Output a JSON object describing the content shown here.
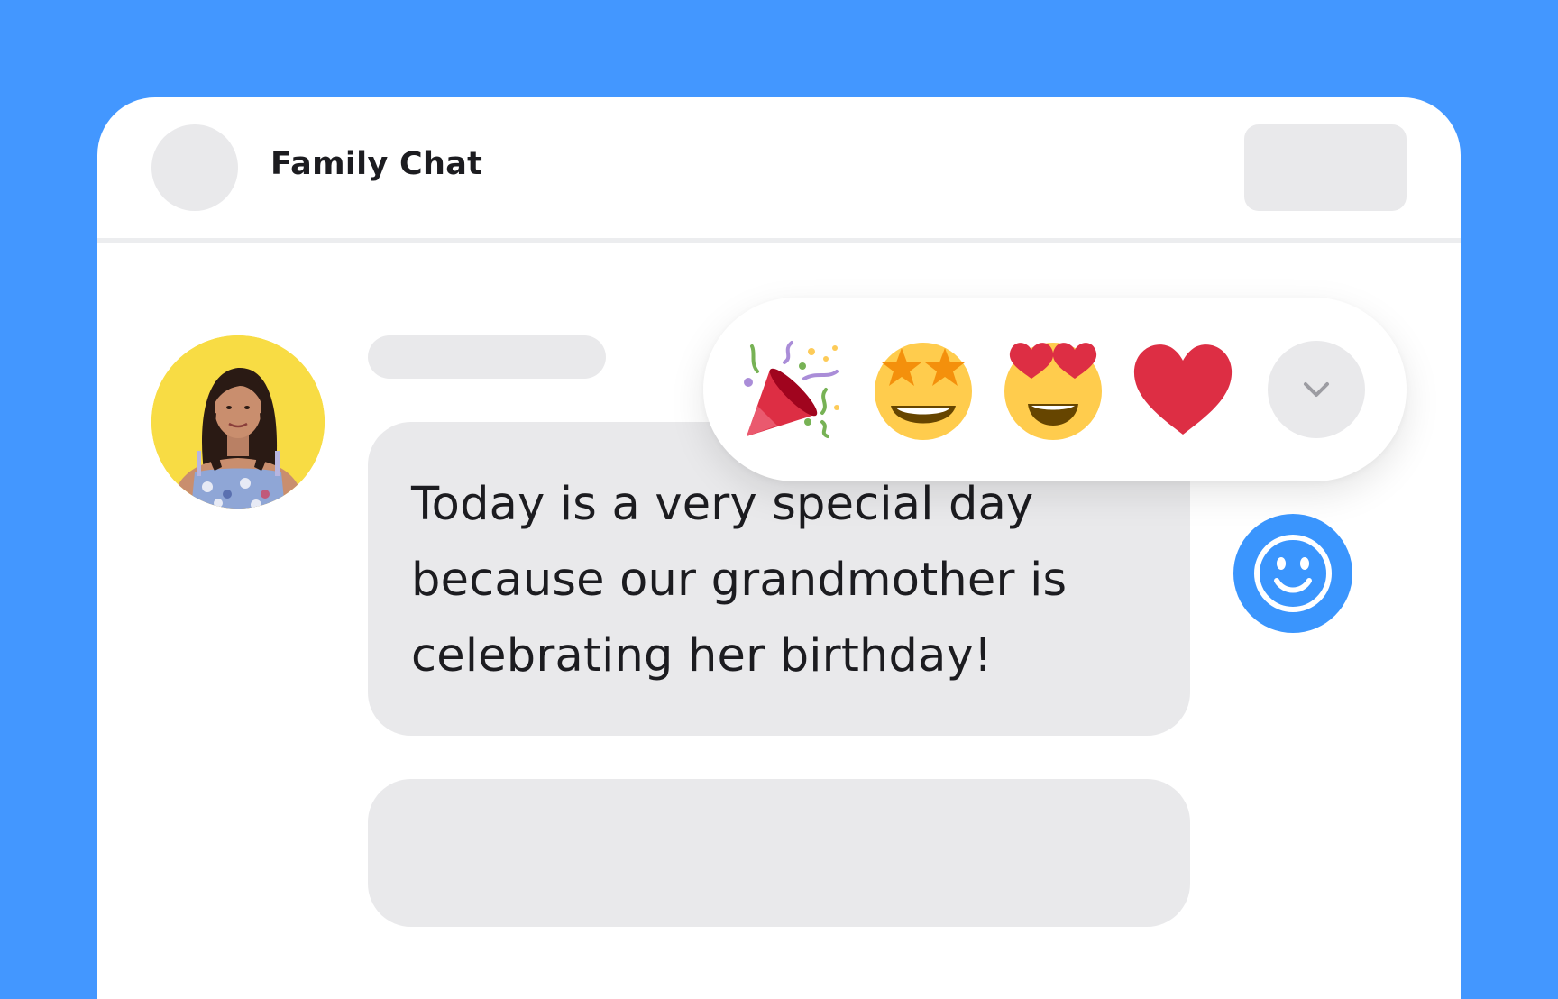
{
  "chat": {
    "title": "Family Chat"
  },
  "message": {
    "text": "Today is a very special day because our grandmother is celebrating her birthday!"
  },
  "reactions": [
    {
      "icon": "party-popper-icon"
    },
    {
      "icon": "star-struck-icon"
    },
    {
      "icon": "heart-eyes-icon"
    },
    {
      "icon": "red-heart-icon"
    }
  ],
  "colors": {
    "background": "#4397FF",
    "accent": "#3A95FD",
    "bubble": "#E9E9EB",
    "avatar_background": "#F8DC44",
    "text": "#1C1C20"
  }
}
